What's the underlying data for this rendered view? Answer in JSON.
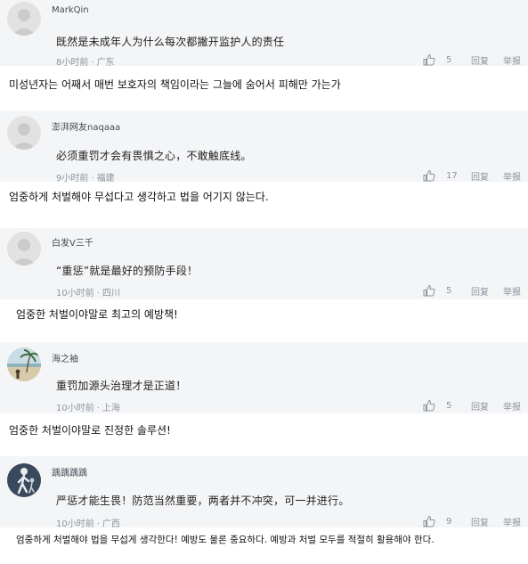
{
  "comments": [
    {
      "username": "MarkQin",
      "text": "既然是未成年人为什么每次都撇开监护人的责任",
      "time": "8小时前",
      "location": "广东",
      "likes": "5",
      "reply_label": "回复",
      "report_label": "举报",
      "avatar_icon": "default-avatar-icon",
      "translation": "미성년자는 어째서 매번 보호자의 책임이라는 그늘에 숨어서 피해만 가는가"
    },
    {
      "username": "澎湃网友naqaaa",
      "text": "必须重罚才会有畏惧之心，不敢触底线。",
      "time": "9小时前",
      "location": "福建",
      "likes": "17",
      "reply_label": "回复",
      "report_label": "举报",
      "avatar_icon": "default-avatar-icon",
      "translation": "엄중하게 처벌해야 무섭다고 생각하고 법을 어기지 않는다."
    },
    {
      "username": "白发V三千",
      "text": "“重惩”就是最好的预防手段！",
      "time": "10小时前",
      "location": "四川",
      "likes": "5",
      "reply_label": "回复",
      "report_label": "举报",
      "avatar_icon": "default-avatar-icon",
      "translation": "엄중한 처벌이야말로 최고의 예방책!"
    },
    {
      "username": "海之袖",
      "text": "重罚加源头治理才是正道！",
      "time": "10小时前",
      "location": "上海",
      "likes": "5",
      "reply_label": "回复",
      "report_label": "举报",
      "avatar_icon": "beach-photo-avatar-icon",
      "translation": "엄중한 처벌이야말로 진정한 솔루션!"
    },
    {
      "username": "踽踽踽踽",
      "text": "严惩才能生畏！防范当然重要，两者并不冲突，可一并进行。",
      "time": "10小时前",
      "location": "广西",
      "likes": "9",
      "reply_label": "回复",
      "report_label": "举报",
      "avatar_icon": "walking-person-avatar-icon",
      "translation": "엄중하게 처벌해야 법을 무섭게 생각한다! 예방도 물론 중요하다. 예방과 처벌 모두를 적절히 활용해야 한다."
    }
  ],
  "colors": {
    "comment_background": "#f4f5f7",
    "translation_background": "#ffffff",
    "meta_text": "#8d949e",
    "body_text": "#222222"
  }
}
